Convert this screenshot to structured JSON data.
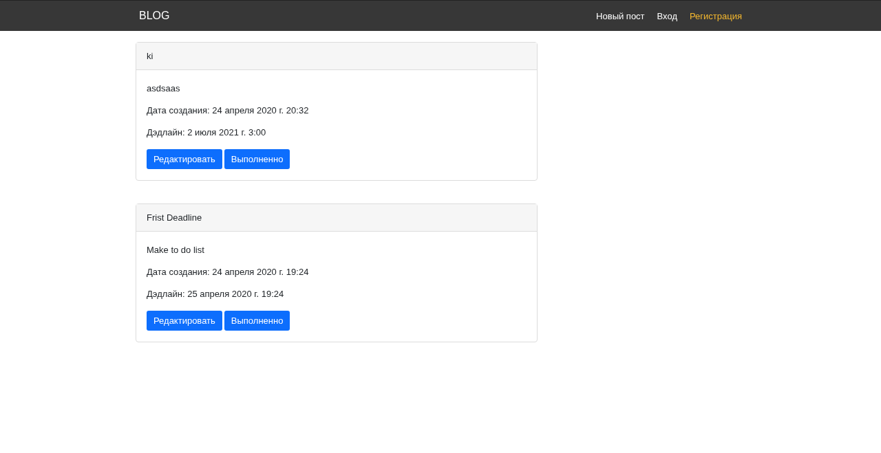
{
  "navbar": {
    "brand": "BLOG",
    "links": [
      {
        "label": "Новый пост",
        "selected": false
      },
      {
        "label": "Вход",
        "selected": false
      },
      {
        "label": "Регистрация",
        "selected": true
      }
    ]
  },
  "posts": [
    {
      "title": "ki",
      "text": "asdsaas",
      "created": "Дата создания: 24 апреля 2020 г. 20:32",
      "deadline": "Дэдлайн: 2 июля 2021 г. 3:00",
      "buttons": [
        "Редактировать",
        "Выполненно"
      ]
    },
    {
      "title": "Frist Deadline",
      "text": "Make to do list",
      "created": "Дата создания: 24 апреля 2020 г. 19:24",
      "deadline": "Дэдлайн: 25 апреля 2020 г. 19:24",
      "buttons": [
        "Редактировать",
        "Выполненно"
      ]
    }
  ]
}
